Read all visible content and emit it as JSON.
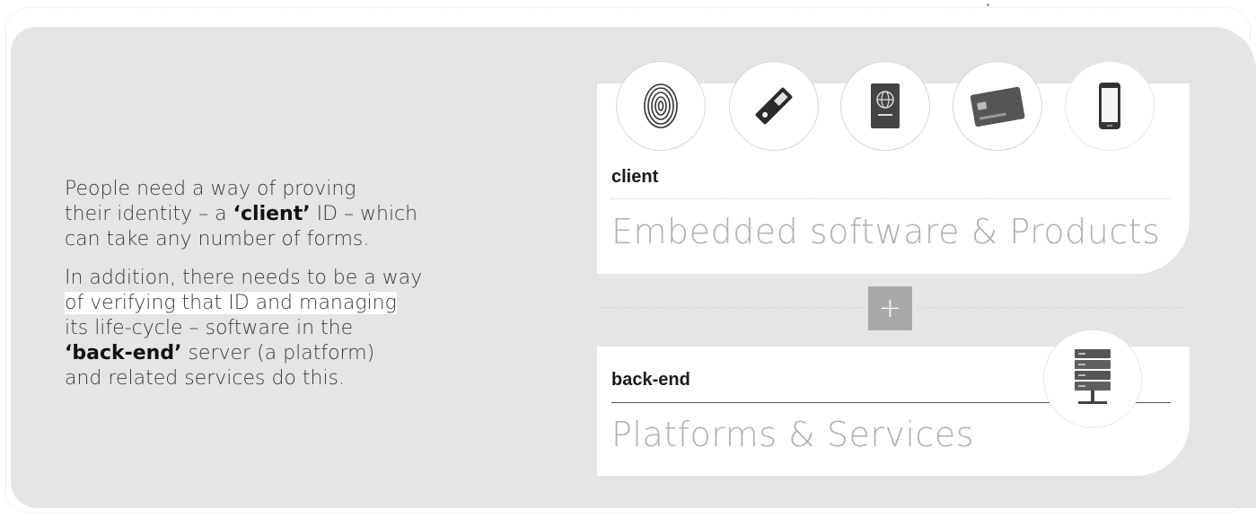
{
  "left_text": {
    "para1": {
      "line1": "People need a way of proving",
      "line2_pre": "their identity – a ",
      "line2_bold": "‘client’",
      "line2_post": " ID – which",
      "line3": "can take any number of forms."
    },
    "para2": {
      "line1": "In addition, there needs to be a way",
      "line2": "of verifying that ID and managing",
      "line3": "its life-cycle – software in the",
      "line4_bold": "‘back-end’",
      "line4_post": " server (a platform)",
      "line5": "and related services do this."
    }
  },
  "client_card": {
    "label": "client",
    "title": "Embedded software & Products",
    "icons": [
      "fingerprint-icon",
      "usb-token-icon",
      "passport-icon",
      "smart-card-icon",
      "smartphone-icon"
    ]
  },
  "connector": {
    "symbol": "+"
  },
  "backend_card": {
    "label": "back-end",
    "title": "Platforms & Services",
    "icon": "server-icon"
  },
  "colors": {
    "panel_bg": "#e5e5e5",
    "card_bg": "#ffffff",
    "plus_bg": "#a9a9a9",
    "title_gray": "#b0b0b0"
  }
}
